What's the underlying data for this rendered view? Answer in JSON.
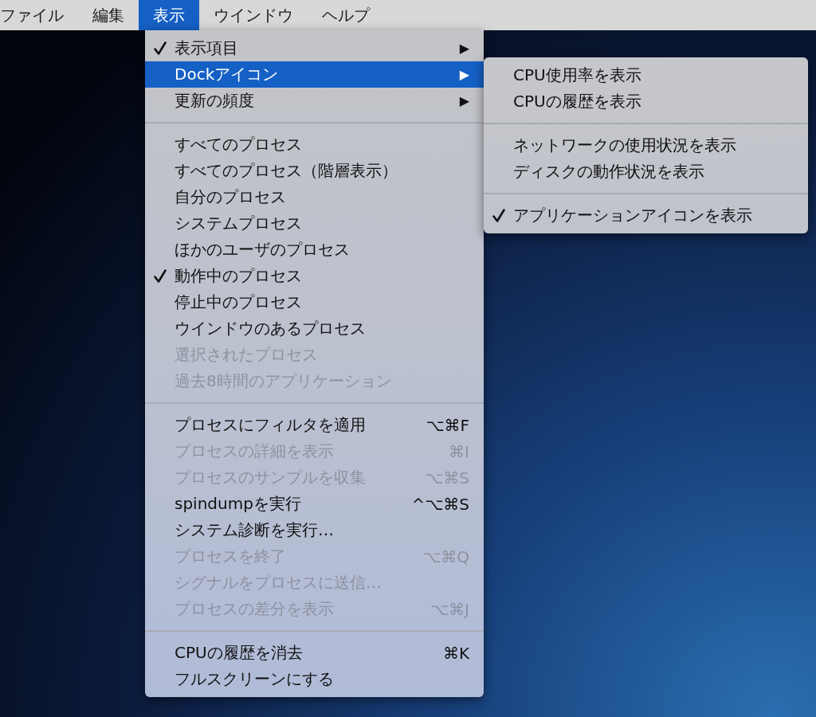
{
  "menu_bar": {
    "items": [
      {
        "label": "ファイル",
        "selected": false
      },
      {
        "label": "編集",
        "selected": false
      },
      {
        "label": "表示",
        "selected": true
      },
      {
        "label": "ウインドウ",
        "selected": false
      },
      {
        "label": "ヘルプ",
        "selected": false
      }
    ]
  },
  "menu": {
    "groups": [
      [
        {
          "label": "表示項目",
          "checked": true,
          "disabled": false,
          "selected": false,
          "arrow": "▶"
        },
        {
          "label": "Dockアイコン",
          "checked": false,
          "disabled": false,
          "selected": true,
          "arrow": "▶"
        },
        {
          "label": "更新の頻度",
          "checked": false,
          "disabled": false,
          "selected": false,
          "arrow": "▶"
        }
      ],
      [
        {
          "label": "すべてのプロセス",
          "checked": false,
          "disabled": false,
          "selected": false
        },
        {
          "label": "すべてのプロセス（階層表示）",
          "checked": false,
          "disabled": false,
          "selected": false
        },
        {
          "label": "自分のプロセス",
          "checked": false,
          "disabled": false,
          "selected": false
        },
        {
          "label": "システムプロセス",
          "checked": false,
          "disabled": false,
          "selected": false
        },
        {
          "label": "ほかのユーザのプロセス",
          "checked": false,
          "disabled": false,
          "selected": false
        },
        {
          "label": "動作中のプロセス",
          "checked": true,
          "disabled": false,
          "selected": false
        },
        {
          "label": "停止中のプロセス",
          "checked": false,
          "disabled": false,
          "selected": false
        },
        {
          "label": "ウインドウのあるプロセス",
          "checked": false,
          "disabled": false,
          "selected": false
        },
        {
          "label": "選択されたプロセス",
          "checked": false,
          "disabled": true,
          "selected": false
        },
        {
          "label": "過去8時間のアプリケーション",
          "checked": false,
          "disabled": true,
          "selected": false
        }
      ],
      [
        {
          "label": "プロセスにフィルタを適用",
          "checked": false,
          "disabled": false,
          "selected": false,
          "shortcut": "⌥⌘F"
        },
        {
          "label": "プロセスの詳細を表示",
          "checked": false,
          "disabled": true,
          "selected": false,
          "shortcut": "⌘I"
        },
        {
          "label": "プロセスのサンプルを収集",
          "checked": false,
          "disabled": true,
          "selected": false,
          "shortcut": "⌥⌘S"
        },
        {
          "label": "spindumpを実行",
          "checked": false,
          "disabled": false,
          "selected": false,
          "shortcut": "^⌥⌘S"
        },
        {
          "label": "システム診断を実行…",
          "checked": false,
          "disabled": false,
          "selected": false
        },
        {
          "label": "プロセスを終了",
          "checked": false,
          "disabled": true,
          "selected": false,
          "shortcut": "⌥⌘Q"
        },
        {
          "label": "シグナルをプロセスに送信…",
          "checked": false,
          "disabled": true,
          "selected": false
        },
        {
          "label": "プロセスの差分を表示",
          "checked": false,
          "disabled": true,
          "selected": false,
          "shortcut": "⌥⌘J"
        }
      ],
      [
        {
          "label": "CPUの履歴を消去",
          "checked": false,
          "disabled": false,
          "selected": false,
          "shortcut": "⌘K"
        },
        {
          "label": "フルスクリーンにする",
          "checked": false,
          "disabled": false,
          "selected": false
        }
      ]
    ]
  },
  "submenu": {
    "groups": [
      [
        {
          "label": "CPU使用率を表示",
          "checked": false,
          "disabled": false,
          "selected": false
        },
        {
          "label": "CPUの履歴を表示",
          "checked": false,
          "disabled": false,
          "selected": false
        }
      ],
      [
        {
          "label": "ネットワークの使用状況を表示",
          "checked": false,
          "disabled": false,
          "selected": false
        },
        {
          "label": "ディスクの動作状況を表示",
          "checked": false,
          "disabled": false,
          "selected": false
        }
      ],
      [
        {
          "label": "アプリケーションアイコンを表示",
          "checked": true,
          "disabled": false,
          "selected": false
        }
      ]
    ]
  }
}
